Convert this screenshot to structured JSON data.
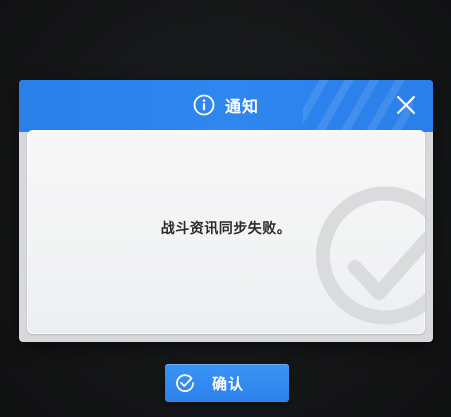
{
  "dialog": {
    "title": "通知",
    "title_icon": "info-icon",
    "close_icon": "close-icon",
    "message": "战斗资讯同步失败。",
    "watermark_icon": "checkmark-icon"
  },
  "confirm_button": {
    "label": "确认",
    "icon": "check-circle-icon"
  },
  "colors": {
    "header_blue": "#2a7fe9",
    "button_blue": "#2c82ea",
    "body_bg": "#f4f5f6",
    "backdrop": "#151617"
  }
}
